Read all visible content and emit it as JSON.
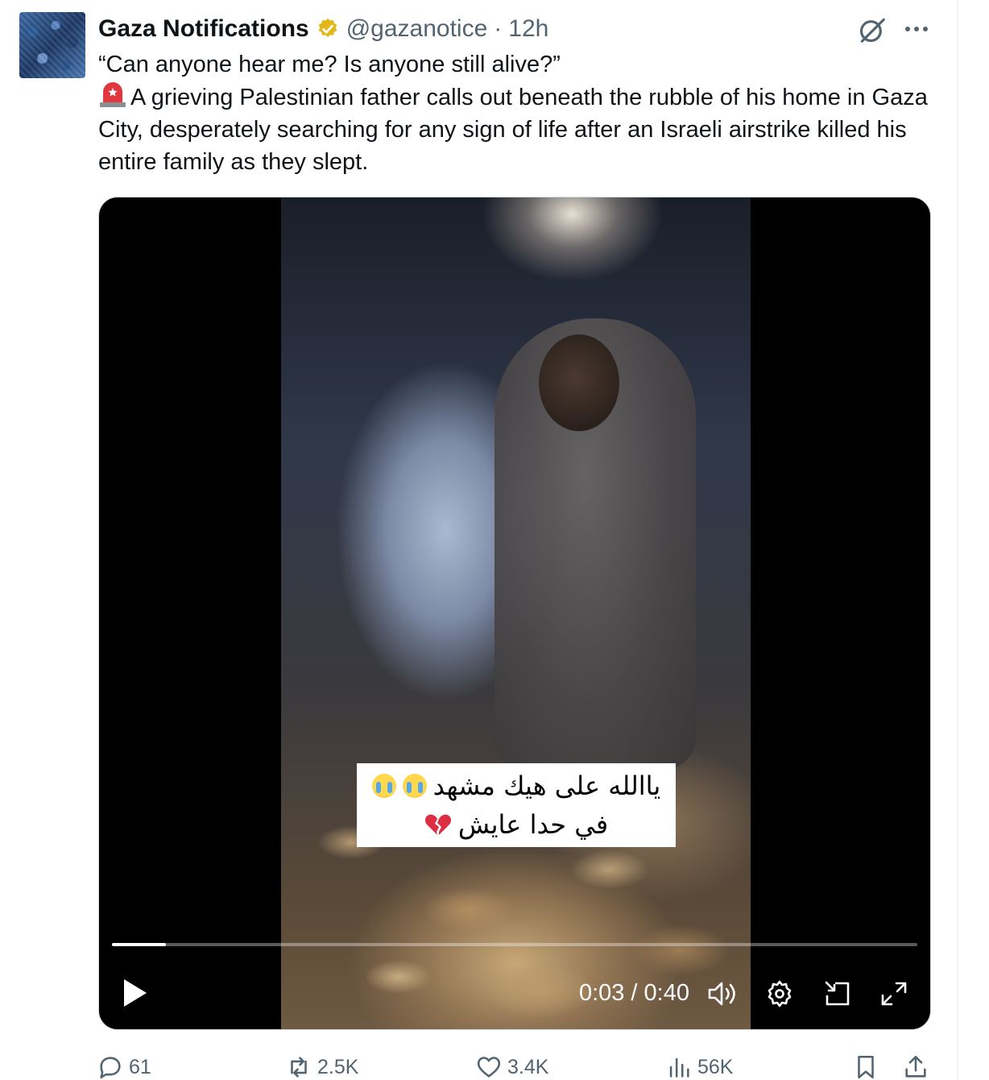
{
  "author": {
    "display_name": "Gaza Notifications",
    "handle": "@gazanotice",
    "separator": "·",
    "time_ago": "12h",
    "verified_color": "#e2b719"
  },
  "tweet": {
    "line1": "“Can anyone hear me? Is anyone still alive?”",
    "line2": "A grieving Palestinian father calls out beneath the rubble of his home in Gaza City, desperately searching for any sign of life after an Israeli airstrike killed his entire family as they slept.",
    "alarm_icon": "police-light-icon"
  },
  "video": {
    "caption_line1": "ياالله على هيك مشهد",
    "caption_line2": "في حدا عايش",
    "time_readout": "0:03 / 0:40",
    "progress_fraction": 0.067
  },
  "actions": {
    "replies": "61",
    "reposts": "2.5K",
    "likes": "3.4K",
    "views": "56K"
  },
  "colors": {
    "text_primary": "#0f1419",
    "text_secondary": "#536471",
    "border": "#cfd9de"
  }
}
